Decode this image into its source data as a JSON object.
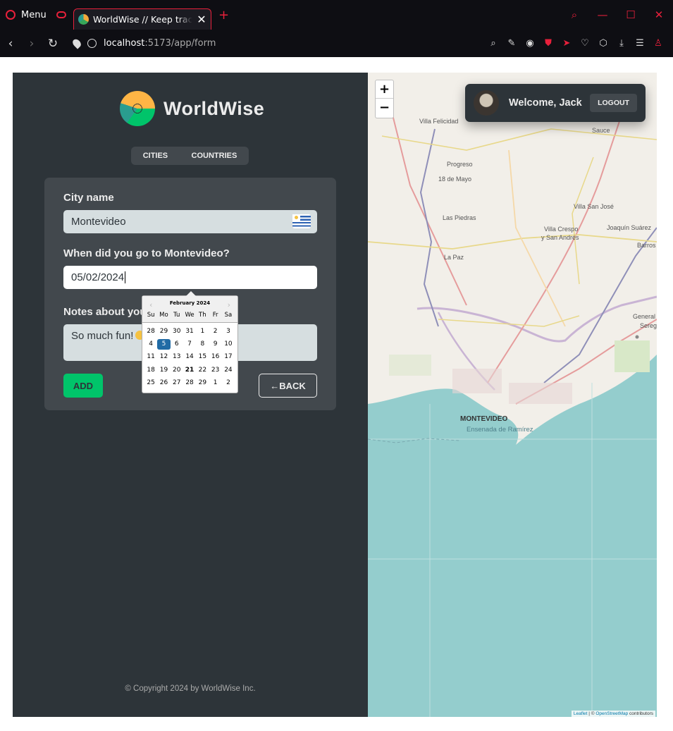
{
  "browser": {
    "menu_label": "Menu",
    "tab_title": "WorldWise // Keep track of",
    "url_host": "localhost",
    "url_path": ":5173/app/form"
  },
  "sidebar": {
    "logo_text": "WorldWise",
    "nav": [
      "CITIES",
      "COUNTRIES"
    ],
    "copyright": "© Copyright 2024 by WorldWise Inc."
  },
  "form": {
    "city_label": "City name",
    "city_value": "Montevideo",
    "date_label": "When did you go to Montevideo?",
    "date_value": "05/02/2024",
    "notes_label": "Notes about you",
    "notes_value": "So much fun!",
    "add_label": "ADD",
    "back_label": "←BACK"
  },
  "datepicker": {
    "month": "February 2024",
    "weekdays": [
      "Su",
      "Mo",
      "Tu",
      "We",
      "Th",
      "Fr",
      "Sa"
    ],
    "days": [
      "28",
      "29",
      "30",
      "31",
      "1",
      "2",
      "3",
      "4",
      "5",
      "6",
      "7",
      "8",
      "9",
      "10",
      "11",
      "12",
      "13",
      "14",
      "15",
      "16",
      "17",
      "18",
      "19",
      "20",
      "21",
      "22",
      "23",
      "24",
      "25",
      "26",
      "27",
      "28",
      "29",
      "1",
      "2"
    ],
    "selected": "5",
    "today": "21"
  },
  "map": {
    "zoom_in": "+",
    "zoom_out": "−",
    "welcome": "Welcome, Jack",
    "logout": "LOGOUT",
    "places": {
      "villa_felicidad": "Villa Felicidad",
      "sauce": "Sauce",
      "progreso": "Progreso",
      "dieciocho_mayo": "18 de Mayo",
      "villa_san_jose": "Villa San José",
      "las_piedras": "Las Piedras",
      "villa_crespo_1": "Villa Crespo",
      "villa_crespo_2": "y San Andrés",
      "joaquin_suarez": "Joaquín Suárez",
      "barros": "Barros",
      "la_paz": "La Paz",
      "general": "General",
      "sereg": "Sereg",
      "montevideo": "MONTEVIDEO",
      "ensenada": "Ensenada de Ramírez"
    },
    "attribution_leaflet": "Leaflet",
    "attribution_sep": " | © ",
    "attribution_osm": "OpenStreetMap",
    "attribution_rest": " contributors"
  },
  "colors": {
    "sidebar_bg": "#2d3439",
    "panel_bg": "#42484d",
    "brand_green": "#00c46a",
    "sea": "#94cdcd"
  }
}
